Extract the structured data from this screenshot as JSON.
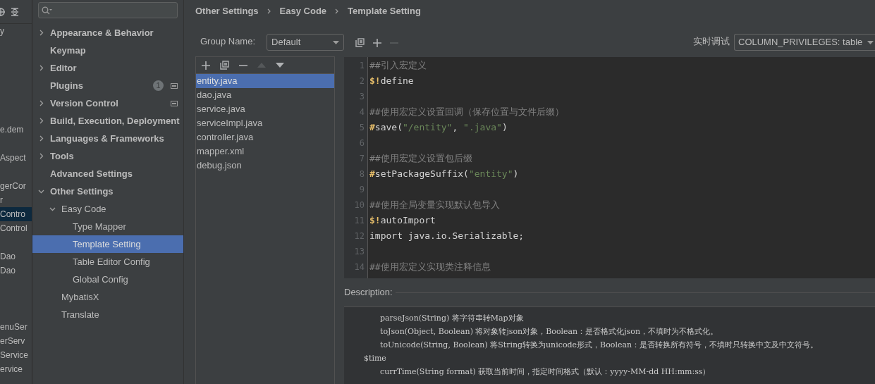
{
  "project_strip": {
    "items": [
      {
        "text": "y",
        "selected": false
      },
      {
        "text": "e.dem",
        "selected": false
      },
      {
        "text": "Aspect",
        "selected": false
      },
      {
        "text": "gerCor",
        "selected": false
      },
      {
        "text": "r",
        "selected": false
      },
      {
        "text": "Contro",
        "selected": true
      },
      {
        "text": "Control",
        "selected": false
      },
      {
        "text": "Dao",
        "selected": false
      },
      {
        "text": "Dao",
        "selected": false
      },
      {
        "text": "enuSer",
        "selected": false
      },
      {
        "text": "erServ",
        "selected": false
      },
      {
        "text": "Service",
        "selected": false
      },
      {
        "text": "ervice",
        "selected": false
      }
    ]
  },
  "sidebar": {
    "items": [
      {
        "label": "Appearance & Behavior",
        "expandable": true,
        "expanded": false,
        "selected": false
      },
      {
        "label": "Keymap",
        "expandable": false,
        "selected": false
      },
      {
        "label": "Editor",
        "expandable": true,
        "expanded": false,
        "selected": false
      },
      {
        "label": "Plugins",
        "expandable": false,
        "selected": false,
        "badge": "1",
        "project_icon": true
      },
      {
        "label": "Version Control",
        "expandable": true,
        "expanded": false,
        "selected": false,
        "project_icon": true
      },
      {
        "label": "Build, Execution, Deployment",
        "expandable": true,
        "expanded": false,
        "selected": false
      },
      {
        "label": "Languages & Frameworks",
        "expandable": true,
        "expanded": false,
        "selected": false
      },
      {
        "label": "Tools",
        "expandable": true,
        "expanded": false,
        "selected": false
      },
      {
        "label": "Advanced Settings",
        "expandable": false,
        "selected": false
      },
      {
        "label": "Other Settings",
        "expandable": true,
        "expanded": true,
        "selected": false,
        "children": [
          {
            "label": "Easy Code",
            "expandable": true,
            "expanded": true,
            "selected": false,
            "children": [
              {
                "label": "Type Mapper",
                "expandable": false,
                "selected": false
              },
              {
                "label": "Template Setting",
                "expandable": false,
                "selected": true
              },
              {
                "label": "Table Editor Config",
                "expandable": false,
                "selected": false
              },
              {
                "label": "Global Config",
                "expandable": false,
                "selected": false
              }
            ]
          },
          {
            "label": "MybatisX",
            "expandable": false,
            "selected": false
          },
          {
            "label": "Translate",
            "expandable": false,
            "selected": false
          }
        ]
      }
    ]
  },
  "breadcrumb": [
    "Other Settings",
    "Easy Code",
    "Template Setting"
  ],
  "group_name": {
    "label": "Group Name:",
    "value": "Default"
  },
  "debug": {
    "label": "实时调试",
    "value": "COLUMN_PRIVILEGES: table"
  },
  "templates": [
    {
      "name": "entity.java",
      "selected": true
    },
    {
      "name": "dao.java",
      "selected": false
    },
    {
      "name": "service.java",
      "selected": false
    },
    {
      "name": "serviceImpl.java",
      "selected": false
    },
    {
      "name": "controller.java",
      "selected": false
    },
    {
      "name": "mapper.xml",
      "selected": false
    },
    {
      "name": "debug.json",
      "selected": false
    }
  ],
  "editor": {
    "lines": [
      {
        "number": "1",
        "tokens": [
          {
            "text": "##引入宏定义",
            "kind": "comment"
          }
        ]
      },
      {
        "number": "2",
        "tokens": [
          {
            "text": "$!",
            "kind": "directive"
          },
          {
            "text": "define",
            "kind": "plain"
          }
        ]
      },
      {
        "number": "3"
      },
      {
        "number": "4",
        "tokens": [
          {
            "text": "##使用宏定义设置回调（保存位置与文件后缀）",
            "kind": "comment"
          }
        ]
      },
      {
        "number": "5",
        "tokens": [
          {
            "text": "#",
            "kind": "directive"
          },
          {
            "text": "save(",
            "kind": "plain"
          },
          {
            "text": "\"/entity\"",
            "kind": "string"
          },
          {
            "text": ", ",
            "kind": "plain"
          },
          {
            "text": "\".java\"",
            "kind": "string"
          },
          {
            "text": ")",
            "kind": "plain"
          }
        ]
      },
      {
        "number": "6"
      },
      {
        "number": "7",
        "tokens": [
          {
            "text": "##使用宏定义设置包后缀",
            "kind": "comment"
          }
        ]
      },
      {
        "number": "8",
        "tokens": [
          {
            "text": "#",
            "kind": "directive"
          },
          {
            "text": "setPackageSuffix(",
            "kind": "plain"
          },
          {
            "text": "\"entity\"",
            "kind": "string"
          },
          {
            "text": ")",
            "kind": "plain"
          }
        ]
      },
      {
        "number": "9"
      },
      {
        "number": "10",
        "tokens": [
          {
            "text": "##使用全局变量实现默认包导入",
            "kind": "comment"
          }
        ]
      },
      {
        "number": "11",
        "tokens": [
          {
            "text": "$!",
            "kind": "directive"
          },
          {
            "text": "autoImport",
            "kind": "plain"
          }
        ]
      },
      {
        "number": "12",
        "tokens": [
          {
            "text": "import java.io.Serializable;",
            "kind": "plain"
          }
        ]
      },
      {
        "number": "13"
      },
      {
        "number": "14",
        "tokens": [
          {
            "text": "##使用宏定义实现类注释信息",
            "kind": "comment"
          }
        ]
      }
    ]
  },
  "description": {
    "label": "Description:",
    "lines": [
      {
        "text": "parseJson(String) 将字符串转Map对象",
        "indented": true
      },
      {
        "text": "toJson(Object, Boolean) 将对象转json对象，Boolean：是否格式化json，不填时为不格式化。",
        "indented": true
      },
      {
        "text": "toUnicode(String, Boolean) 将String转换为unicode形式，Boolean：是否转换所有符号，不填时只转换中文及中文符号。",
        "indented": true
      },
      {
        "text": "$time",
        "indented": false
      },
      {
        "text": "currTime(String format) 获取当前时间，指定时间格式（默认：yyyy-MM-dd HH:mm:ss）",
        "indented": true
      }
    ]
  }
}
